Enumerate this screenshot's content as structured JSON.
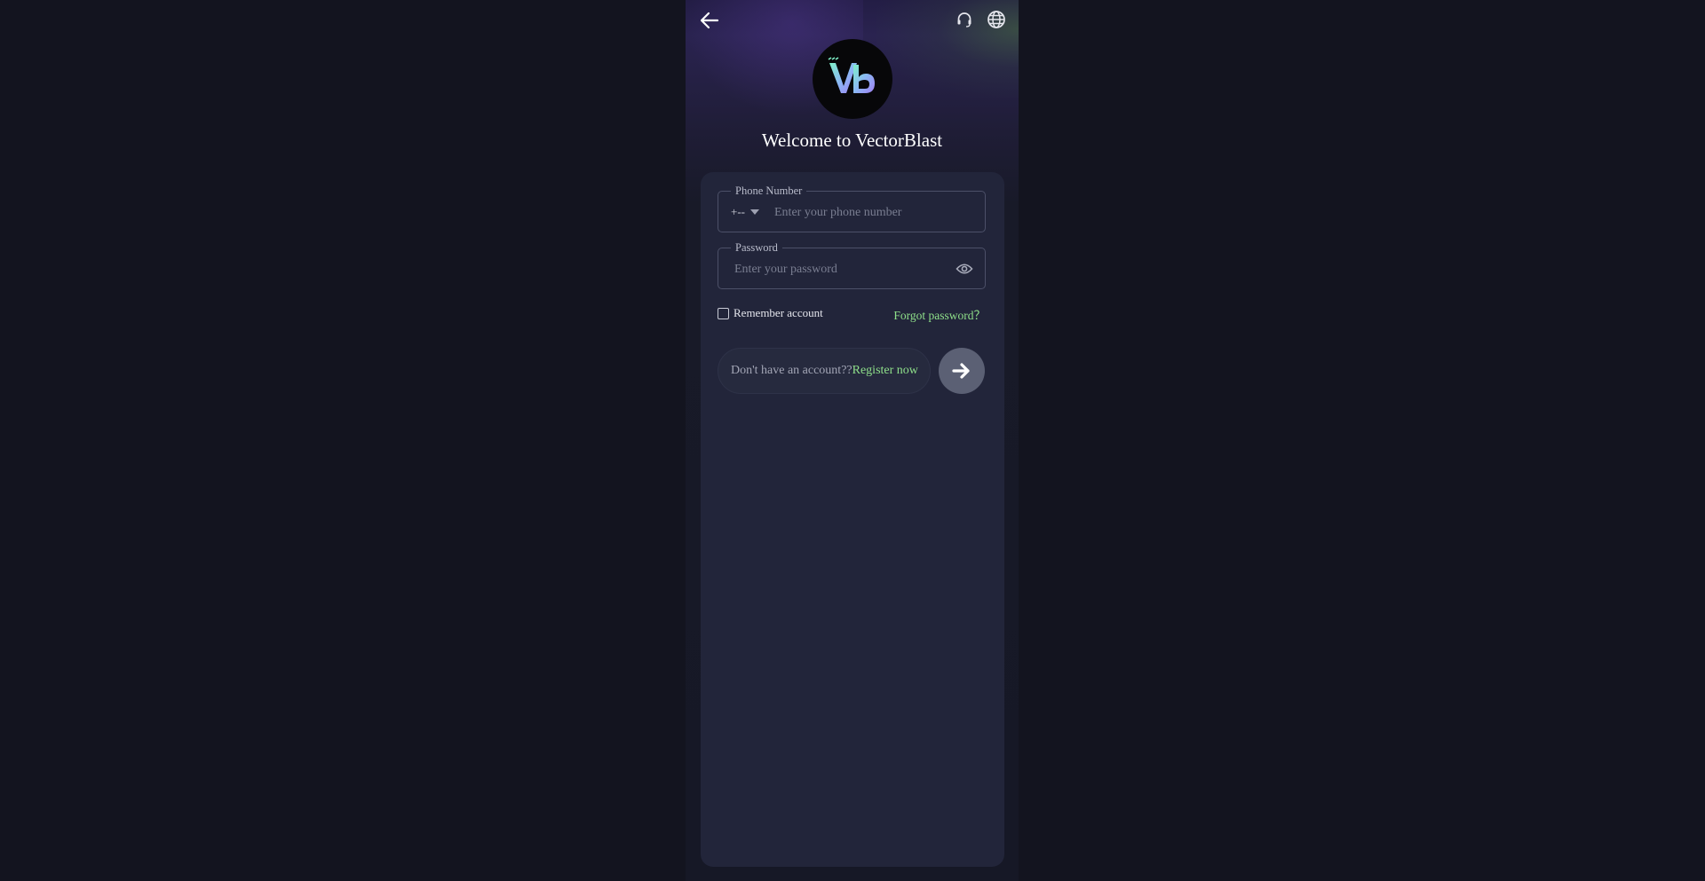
{
  "header": {
    "back_icon": "arrow-left-icon",
    "support_icon": "headset-icon",
    "language_icon": "globe-icon"
  },
  "brand": {
    "logo_icon": "vectorblast-logo",
    "welcome_text": "Welcome to VectorBlast"
  },
  "form": {
    "phone": {
      "label": "Phone Number",
      "country_code": "+--",
      "placeholder": "Enter your phone number",
      "value": ""
    },
    "password": {
      "label": "Password",
      "placeholder": "Enter your password",
      "value": "",
      "toggle_icon": "eye-icon"
    },
    "remember_label": "Remember account",
    "remember_checked": false,
    "forgot_label": "Forgot password？"
  },
  "register": {
    "question": "Don't have an account??",
    "link_label": "Register now"
  },
  "submit": {
    "icon": "arrow-right-icon"
  },
  "colors": {
    "page_bg": "#13141f",
    "card_bg": "#22253a",
    "accent_green": "#8fe08a",
    "submit_bg": "#5b6074"
  }
}
